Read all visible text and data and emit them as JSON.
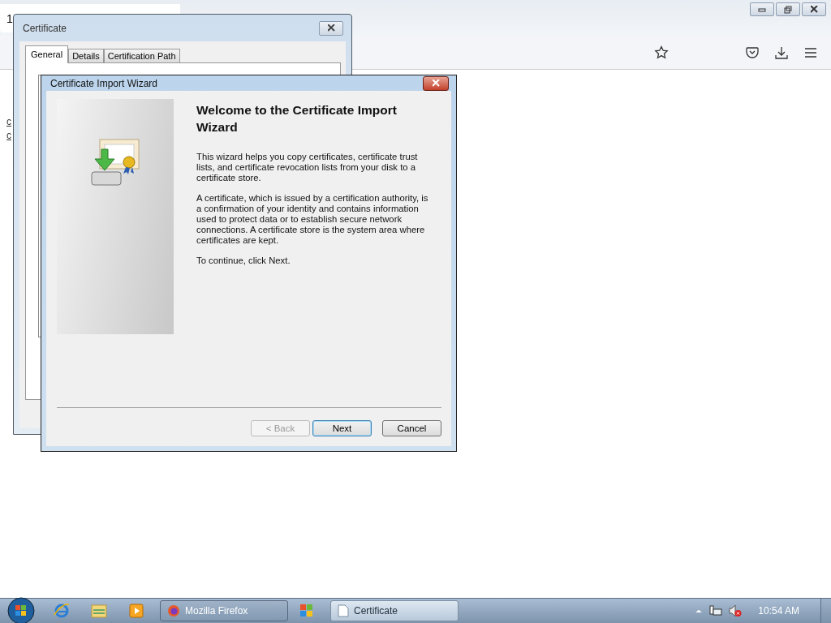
{
  "browser": {
    "tab": {
      "label": "1"
    },
    "page": {
      "links": [
        "c",
        "c"
      ]
    }
  },
  "certificate_window": {
    "title": "Certificate",
    "tabs": [
      {
        "label": "General",
        "selected": true
      },
      {
        "label": "Details",
        "selected": false
      },
      {
        "label": "Certification Path",
        "selected": false
      }
    ]
  },
  "wizard": {
    "title": "Certificate Import Wizard",
    "heading": "Welcome to the Certificate Import Wizard",
    "paragraphs": [
      "This wizard helps you copy certificates, certificate trust lists, and certificate revocation lists from your disk to a certificate store.",
      "A certificate, which is issued by a certification authority, is a confirmation of your identity and contains information used to protect data or to establish secure network connections. A certificate store is the system area where certificates are kept.",
      "To continue, click Next."
    ],
    "buttons": [
      {
        "label": "< Back",
        "disabled": true,
        "focused": false
      },
      {
        "label": "Next",
        "disabled": false,
        "focused": true
      },
      {
        "label": "Cancel",
        "disabled": false,
        "focused": false
      }
    ]
  },
  "taskbar": {
    "buttons": [
      {
        "label": "Mozilla Firefox",
        "selected": false
      },
      {
        "label": "Certificate",
        "selected": true
      }
    ],
    "clock": "10:54 AM"
  }
}
